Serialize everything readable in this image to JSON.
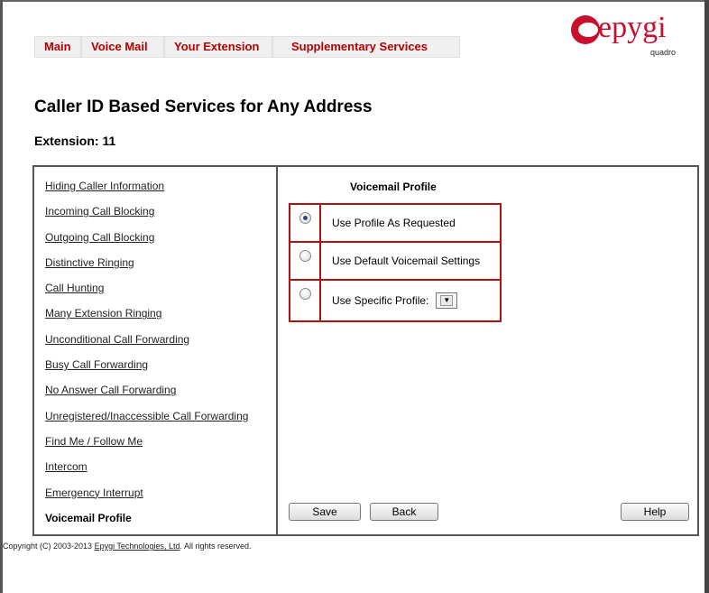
{
  "nav": {
    "tabs": [
      "Main",
      "Voice Mail",
      "Your Extension",
      "Supplementary Services"
    ]
  },
  "logo": {
    "word": "epygi",
    "sub": "quadro"
  },
  "page": {
    "title": "Caller ID Based Services for Any Address",
    "extension_label": "Extension: 11"
  },
  "sidebar": {
    "items": [
      "Hiding Caller Information",
      "Incoming Call Blocking",
      "Outgoing Call Blocking",
      "Distinctive Ringing",
      "Call Hunting",
      "Many Extension Ringing",
      "Unconditional Call Forwarding",
      "Busy Call Forwarding",
      "No Answer Call Forwarding",
      "Unregistered/Inaccessible Call Forwarding",
      "Find Me / Follow Me",
      "Intercom",
      "Emergency Interrupt",
      "Voicemail Profile"
    ],
    "active": "Voicemail Profile"
  },
  "content": {
    "section_title": "Voicemail Profile",
    "options": [
      {
        "label": "Use Profile As Requested",
        "checked": true
      },
      {
        "label": "Use Default Voicemail Settings",
        "checked": false
      },
      {
        "label": "Use Specific Profile:",
        "checked": false
      }
    ],
    "select_value": ""
  },
  "buttons": {
    "save": "Save",
    "back": "Back",
    "help": "Help"
  },
  "footer": {
    "prefix": "Copyright (C) 2003-2013 ",
    "link": "Epygi Technologies, Ltd",
    "suffix": ". All rights reserved."
  },
  "colors": {
    "accent": "#b30000",
    "option_border": "#b01010"
  }
}
